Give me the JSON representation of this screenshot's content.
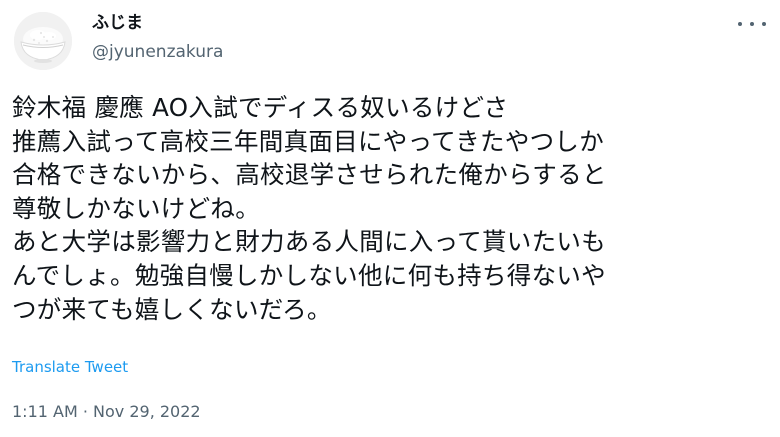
{
  "author": {
    "display_name": "ふじま",
    "handle": "@jyunenzakura",
    "avatar_icon": "rice-bowl-icon"
  },
  "tweet": {
    "text": "鈴木福 慶應 AO入試でディスる奴いるけどさ\n推薦入試って高校三年間真面目にやってきたやつしか\n合格できないから、高校退学させられた俺からすると\n尊敬しかないけどね。\nあと大学は影響力と財力ある人間に入って貰いたいも\nんでしょ。勉強自慢しかしない他に何も持ち得ないや\nつが来ても嬉しくないだろ。",
    "translate_label": "Translate Tweet",
    "timestamp": "1:11 AM · Nov 29, 2022"
  },
  "actions": {
    "more_icon": "more-dots-icon"
  },
  "colors": {
    "text": "#0f1419",
    "secondary": "#536471",
    "link": "#1d9bf0",
    "background": "#ffffff"
  }
}
